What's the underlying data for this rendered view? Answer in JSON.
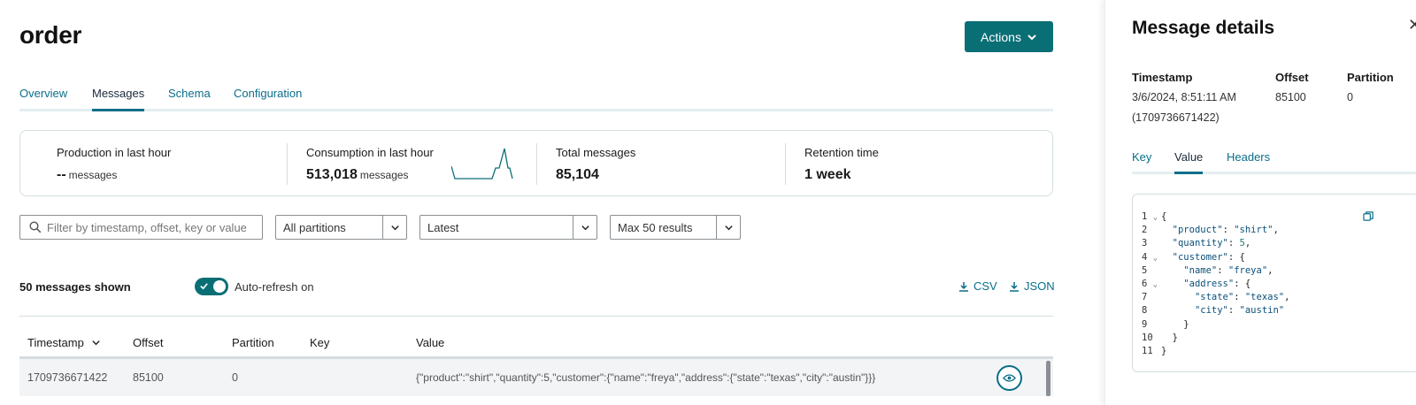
{
  "page": {
    "title": "order",
    "actions_label": "Actions"
  },
  "tabs": [
    {
      "label": "Overview",
      "active": false
    },
    {
      "label": "Messages",
      "active": true
    },
    {
      "label": "Schema",
      "active": false
    },
    {
      "label": "Configuration",
      "active": false
    }
  ],
  "stats": {
    "production": {
      "label": "Production in last hour",
      "value": "--",
      "unit": "messages"
    },
    "consumption": {
      "label": "Consumption in last hour",
      "value": "513,018",
      "unit": "messages"
    },
    "total": {
      "label": "Total messages",
      "value": "85,104"
    },
    "retention": {
      "label": "Retention time",
      "value": "1 week"
    }
  },
  "filters": {
    "search_placeholder": "Filter by timestamp, offset, key or value",
    "partitions": "All partitions",
    "position": "Latest",
    "limit": "Max 50 results"
  },
  "toolbar": {
    "count_label": "50 messages shown",
    "auto_refresh_label": "Auto-refresh on",
    "auto_refresh_on": true,
    "csv_label": "CSV",
    "json_label": "JSON"
  },
  "table": {
    "columns": [
      "Timestamp",
      "Offset",
      "Partition",
      "Key",
      "Value"
    ],
    "rows": [
      {
        "timestamp": "1709736671422",
        "offset": "85100",
        "partition": "0",
        "key": "",
        "value": "{\"product\":\"shirt\",\"quantity\":5,\"customer\":{\"name\":\"freya\",\"address\":{\"state\":\"texas\",\"city\":\"austin\"}}}"
      }
    ]
  },
  "details": {
    "title": "Message details",
    "timestamp_label": "Timestamp",
    "timestamp_value": "3/6/2024, 8:51:11 AM",
    "timestamp_raw": "(1709736671422)",
    "offset_label": "Offset",
    "offset_value": "85100",
    "partition_label": "Partition",
    "partition_value": "0",
    "tabs": [
      {
        "label": "Key",
        "active": false
      },
      {
        "label": "Value",
        "active": true
      },
      {
        "label": "Headers",
        "active": false
      }
    ]
  },
  "colors": {
    "accent": "#0a6e75",
    "link": "#0a6e8a"
  }
}
